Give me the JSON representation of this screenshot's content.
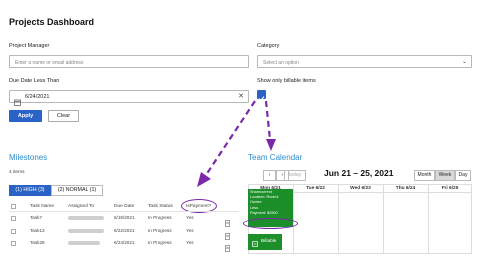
{
  "header": {
    "title": "Projects Dashboard"
  },
  "filters": {
    "project_manager_label": "Project Manager",
    "project_manager_placeholder": "Enter a name or email address",
    "category_label": "Category",
    "category_placeholder": "Select an option",
    "due_date_label": "Due Date Less Than",
    "due_date_value": "6/24/2021",
    "billable_label": "Show only billable items",
    "apply_label": "Apply",
    "clear_label": "Clear"
  },
  "milestones": {
    "title": "Milestones",
    "count": "4 items",
    "tab_high": "(1) HIGH (3)",
    "tab_normal": "(2) NORMAL (1)",
    "columns": [
      "Task Name",
      "Assigned To",
      "Due Date",
      "Task Status",
      "IsPayment?"
    ],
    "rows": [
      {
        "name": "Task7",
        "due": "6/19/2021",
        "status": "In Progress",
        "payment": "Yes"
      },
      {
        "name": "Task13",
        "due": "6/22/2021",
        "status": "In Progress",
        "payment": "Yes"
      },
      {
        "name": "Task28",
        "due": "6/24/2021",
        "status": "In Progress",
        "payment": "Yes"
      }
    ]
  },
  "calendar": {
    "title": "Team Calendar",
    "today_label": "today",
    "date_range": "Jun 21 – 25, 2021",
    "views": [
      "Month",
      "Week",
      "Day"
    ],
    "days": [
      "Mon 6/21",
      "Tue 6/22",
      "Wed 6/23",
      "Thu 6/24",
      "Fri 6/25"
    ],
    "event": {
      "line1": "Sharecurrent",
      "line2": "Location: Room1",
      "line3": "Owner:",
      "line4": "Less",
      "line5": "Payment: $2500"
    },
    "billable_label": "Billable"
  },
  "colors": {
    "accent": "#2b62c6",
    "section": "#2f8ec9",
    "event": "#1c8e2a",
    "annotation": "#7a2aa8"
  }
}
